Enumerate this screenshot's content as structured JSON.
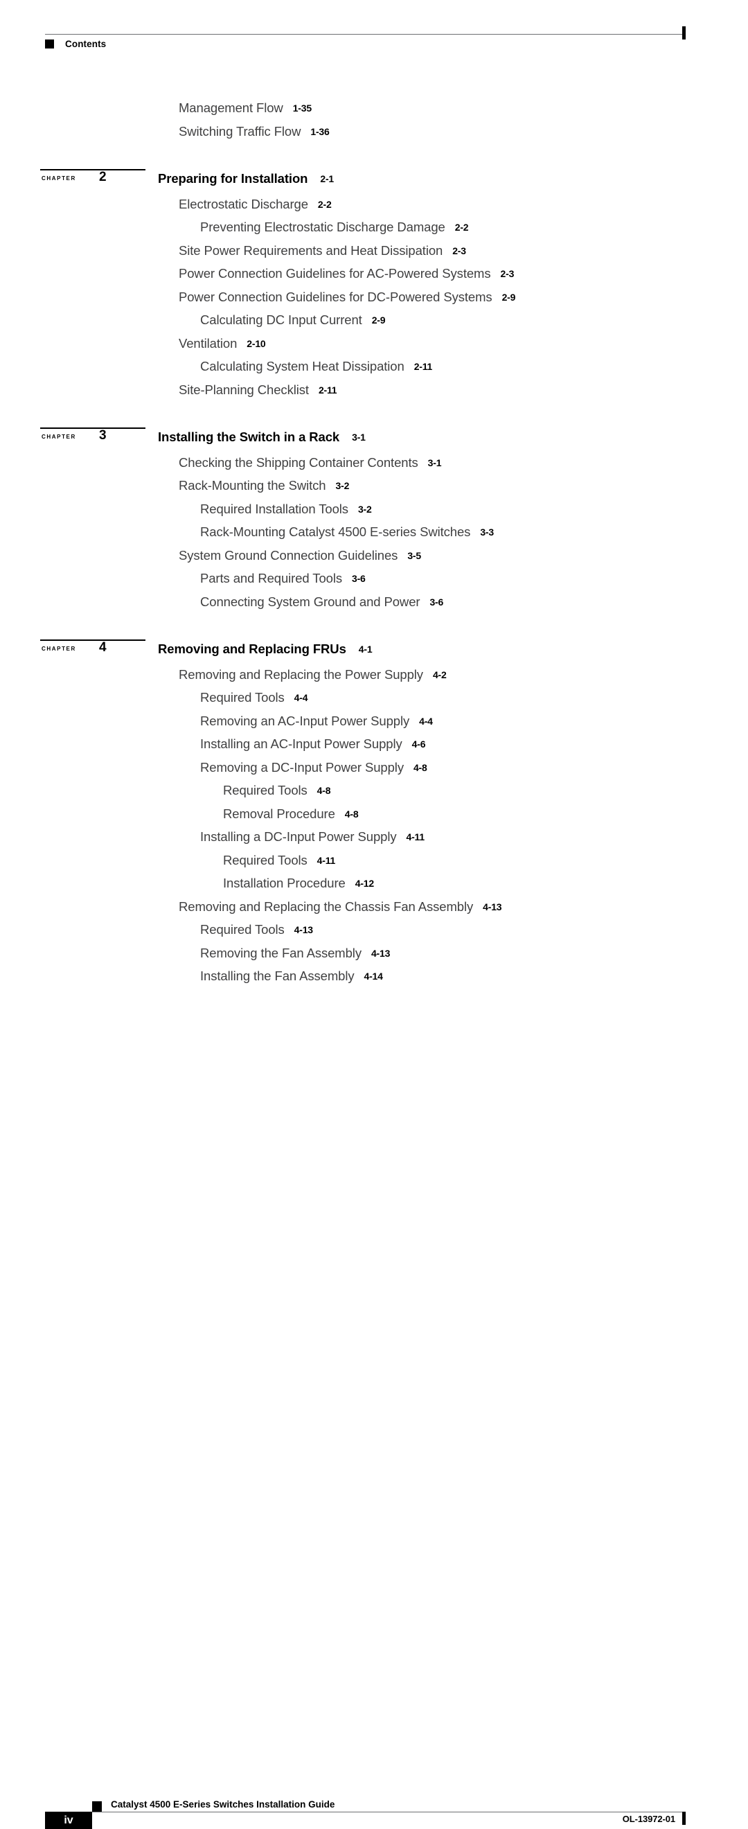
{
  "header": {
    "label": "Contents",
    "bullet_icon": "square-bullet-icon"
  },
  "toc": {
    "leading_entries": [
      {
        "level": 1,
        "title": "Management Flow",
        "page": "1-35"
      },
      {
        "level": 1,
        "title": "Switching Traffic Flow",
        "page": "1-36"
      }
    ],
    "chapters": [
      {
        "chapter_word": "CHAPTER",
        "number": "2",
        "title": "Preparing for Installation",
        "page": "2-1",
        "entries": [
          {
            "level": 1,
            "title": "Electrostatic Discharge",
            "page": "2-2"
          },
          {
            "level": 2,
            "title": "Preventing Electrostatic Discharge Damage",
            "page": "2-2"
          },
          {
            "level": 1,
            "title": "Site Power Requirements and Heat Dissipation",
            "page": "2-3"
          },
          {
            "level": 1,
            "title": "Power Connection Guidelines for AC-Powered Systems",
            "page": "2-3"
          },
          {
            "level": 1,
            "title": "Power Connection Guidelines for DC-Powered Systems",
            "page": "2-9"
          },
          {
            "level": 2,
            "title": "Calculating DC Input Current",
            "page": "2-9"
          },
          {
            "level": 1,
            "title": "Ventilation",
            "page": "2-10"
          },
          {
            "level": 2,
            "title": "Calculating System Heat Dissipation",
            "page": "2-11"
          },
          {
            "level": 1,
            "title": "Site-Planning Checklist",
            "page": "2-11"
          }
        ]
      },
      {
        "chapter_word": "CHAPTER",
        "number": "3",
        "title": "Installing the Switch in a Rack",
        "page": "3-1",
        "entries": [
          {
            "level": 1,
            "title": "Checking the Shipping Container Contents",
            "page": "3-1"
          },
          {
            "level": 1,
            "title": "Rack-Mounting the Switch",
            "page": "3-2"
          },
          {
            "level": 2,
            "title": "Required Installation Tools",
            "page": "3-2"
          },
          {
            "level": 2,
            "title": "Rack-Mounting Catalyst 4500 E-series Switches",
            "page": "3-3"
          },
          {
            "level": 1,
            "title": "System Ground Connection Guidelines",
            "page": "3-5"
          },
          {
            "level": 2,
            "title": "Parts and Required Tools",
            "page": "3-6"
          },
          {
            "level": 2,
            "title": "Connecting System Ground and Power",
            "page": "3-6"
          }
        ]
      },
      {
        "chapter_word": "CHAPTER",
        "number": "4",
        "title": "Removing and Replacing FRUs",
        "page": "4-1",
        "entries": [
          {
            "level": 1,
            "title": "Removing and Replacing the Power Supply",
            "page": "4-2"
          },
          {
            "level": 2,
            "title": "Required Tools",
            "page": "4-4"
          },
          {
            "level": 2,
            "title": "Removing an AC-Input Power Supply",
            "page": "4-4"
          },
          {
            "level": 2,
            "title": "Installing an AC-Input Power Supply",
            "page": "4-6"
          },
          {
            "level": 2,
            "title": "Removing a DC-Input Power Supply",
            "page": "4-8"
          },
          {
            "level": 3,
            "title": "Required Tools",
            "page": "4-8"
          },
          {
            "level": 3,
            "title": "Removal Procedure",
            "page": "4-8"
          },
          {
            "level": 2,
            "title": "Installing a DC-Input Power Supply",
            "page": "4-11"
          },
          {
            "level": 3,
            "title": "Required Tools",
            "page": "4-11"
          },
          {
            "level": 3,
            "title": "Installation Procedure",
            "page": "4-12"
          },
          {
            "level": 1,
            "title": "Removing and Replacing the Chassis Fan Assembly",
            "page": "4-13"
          },
          {
            "level": 2,
            "title": "Required Tools",
            "page": "4-13"
          },
          {
            "level": 2,
            "title": "Removing the Fan Assembly",
            "page": "4-13"
          },
          {
            "level": 2,
            "title": "Installing the Fan Assembly",
            "page": "4-14"
          }
        ]
      }
    ]
  },
  "footer": {
    "bullet_icon": "square-bullet-icon",
    "document_title": "Catalyst 4500 E-Series Switches Installation Guide",
    "page_number": "iv",
    "document_id": "OL-13972-01"
  },
  "colors": {
    "text": "#404041",
    "page_number_bold": "#000000",
    "rule": "#6d6e71",
    "black": "#000000",
    "background": "#ffffff"
  }
}
